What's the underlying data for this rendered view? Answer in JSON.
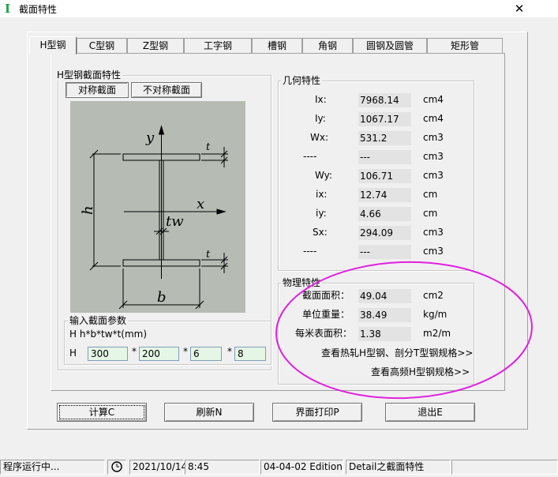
{
  "window": {
    "title": "截面特性",
    "app_icon": "I",
    "close": "✕"
  },
  "tabs": [
    {
      "label": "H型钢",
      "active": true
    },
    {
      "label": "C型钢"
    },
    {
      "label": "Z型钢"
    },
    {
      "label": "工字钢"
    },
    {
      "label": "槽钢"
    },
    {
      "label": "角钢"
    },
    {
      "label": "圆钢及圆管"
    },
    {
      "label": "矩形管"
    }
  ],
  "section_group": {
    "title": "H型钢截面特性",
    "sym_button": "对称截面",
    "asym_button": "不对称截面",
    "figure_labels": {
      "y": "y",
      "x": "x",
      "h": "h",
      "b": "b",
      "tw": "tw",
      "t_top": "t",
      "t_bottom": "t"
    }
  },
  "input_group": {
    "title": "输入截面参数",
    "hint": "H  h*b*tw*t(mm)",
    "prefix": "H",
    "times": "*",
    "values": [
      "300",
      "200",
      "6",
      "8"
    ]
  },
  "geometry": {
    "title": "几何特性",
    "rows": [
      {
        "label": "Ix:",
        "value": "7968.14",
        "unit": "cm4"
      },
      {
        "label": "Iy:",
        "value": "1067.17",
        "unit": "cm4"
      },
      {
        "label": "Wx:",
        "value": "531.2",
        "unit": "cm3"
      },
      {
        "label": "----",
        "value": "---",
        "unit": "cm3"
      },
      {
        "label": "Wy:",
        "value": "106.71",
        "unit": "cm3"
      },
      {
        "label": "ix:",
        "value": "12.74",
        "unit": "cm"
      },
      {
        "label": "iy:",
        "value": "4.66",
        "unit": "cm"
      },
      {
        "label": "Sx:",
        "value": "294.09",
        "unit": "cm3"
      },
      {
        "label": "----",
        "value": "---",
        "unit": "cm3"
      }
    ]
  },
  "physical": {
    "title": "物理特性",
    "rows": [
      {
        "label": "截面面积：",
        "value": "49.04",
        "unit": "cm2"
      },
      {
        "label": "单位重量：",
        "value": "38.49",
        "unit": "kg/m"
      },
      {
        "label": "每米表面积：",
        "value": "1.38",
        "unit": "m2/m"
      }
    ],
    "link1": "查看热轧H型钢、剖分T型钢规格>>",
    "link2": "查看高频H型钢规格>>"
  },
  "buttons": {
    "calc": "计算C",
    "refresh": "刷新N",
    "print": "界面打印P",
    "exit": "退出E"
  },
  "status": {
    "running": "程序运行中...",
    "date": "2021/10/14",
    "time": "8:45",
    "edition": "04-04-02 Edition",
    "module": "Detail之截面特性"
  },
  "colors": {
    "annotation": "#e020e0",
    "input_bg": "#e6f6e6",
    "figure_bg": "#b6bbb4"
  }
}
